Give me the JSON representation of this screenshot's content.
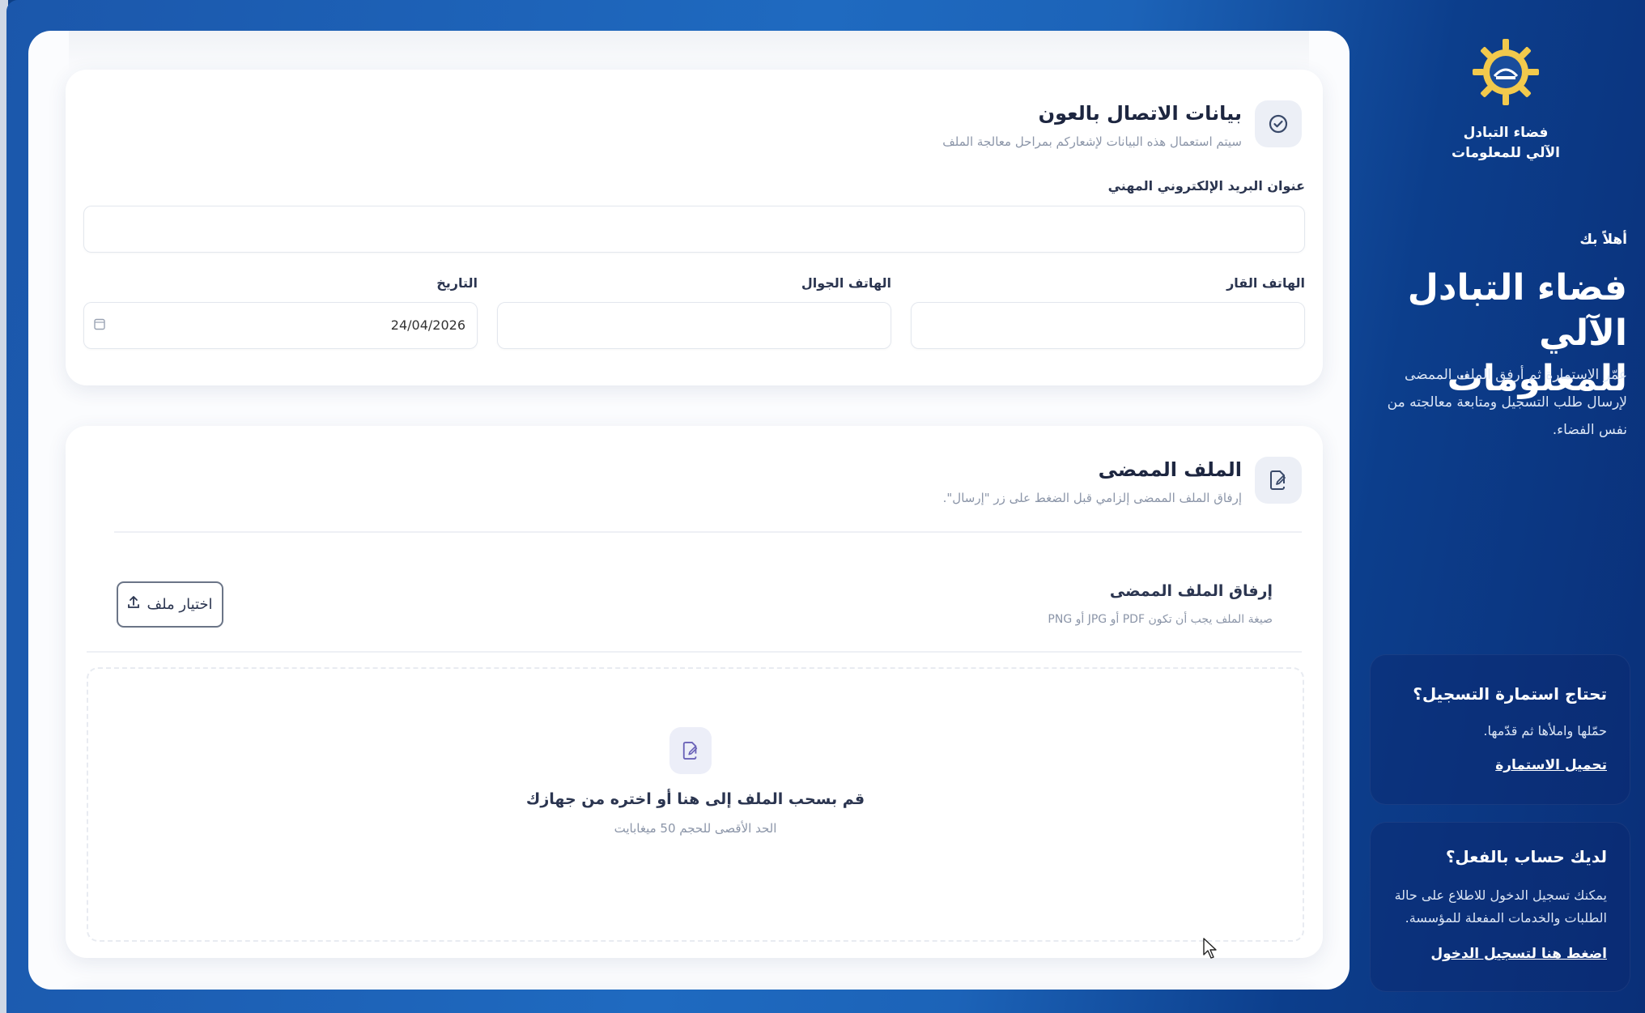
{
  "contact_section": {
    "title": "بيانات الاتصال بالعون",
    "subtitle": "سيتم استعمال هذه البيانات لإشعاركم بمراحل معالجة الملف",
    "email_label": "عنوان البريد الإلكتروني المهني",
    "email_value": "",
    "landline_label": "الهاتف القار",
    "landline_value": "",
    "mobile_label": "الهاتف الجوال",
    "mobile_value": "",
    "date_label": "التاريخ",
    "date_value": "24/04/2026"
  },
  "file_section": {
    "title": "الملف الممضى",
    "subtitle": "إرفاق الملف الممضى إلزامي قبل الضغط على زر \"إرسال\".",
    "attach_label": "إرفاق الملف الممضى",
    "attach_hint": "صيغة الملف يجب أن تكون PDF أو JPG أو PNG",
    "choose_button": "اختيار ملف",
    "drop_title": "قم بسحب الملف إلى هنا أو اختره من جهازك",
    "drop_limit": "الحد الأقصى للحجم 50 ميغابايت"
  },
  "sidebar": {
    "logo_text_line1": "فضاء التبادل",
    "logo_text_line2": "الآلي للمعلومات",
    "welcome": "أهلاً بك",
    "brand_title": "فضاء التبادل الآلي للمعلومات",
    "brand_description": "عمّر الاستمارة ثم أرفق الملف الممضى لإرسال طلب التسجيل ومتابعة معالجته من نفس الفضاء.",
    "card_form": {
      "title": "تحتاج استمارة التسجيل؟",
      "text": "حمّلها واملأها ثم قدّمها.",
      "link": "تحميل الاستمارة"
    },
    "card_account": {
      "title": "لديك حساب بالفعل؟",
      "text": "يمكنك تسجيل الدخول للاطلاع على حالة الطلبات والخدمات المفعلة للمؤسسة.",
      "link": "اضغط هنا لتسجيل الدخول"
    }
  },
  "colors": {
    "sidebar_gradient_start": "#1f6ac0",
    "sidebar_gradient_end": "#0a2f78",
    "card_background": "#fbfcfe",
    "accent_icon": "#6a62b8"
  },
  "icons": [
    "check-circle-icon",
    "file-edit-icon",
    "upload-icon",
    "calendar-icon",
    "logo-gear-icon",
    "mouse-cursor-icon"
  ]
}
